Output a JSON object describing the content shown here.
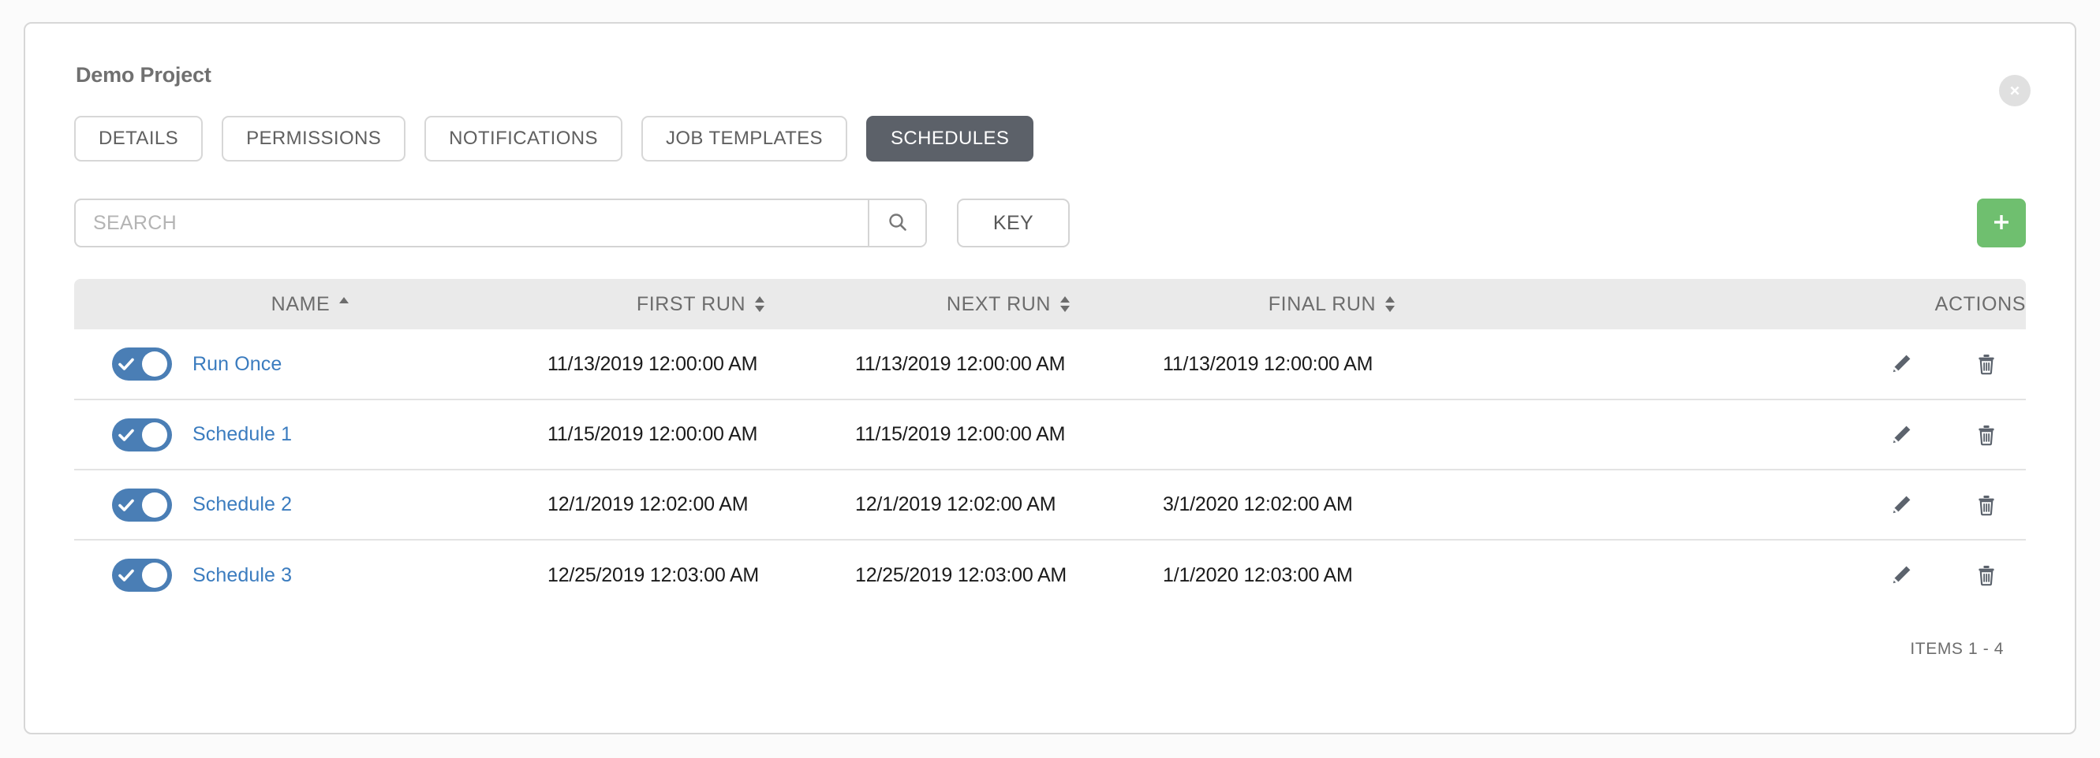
{
  "header": {
    "title": "Demo Project",
    "close_icon": "close-circle-icon"
  },
  "tabs": [
    {
      "label": "DETAILS",
      "active": false
    },
    {
      "label": "PERMISSIONS",
      "active": false
    },
    {
      "label": "NOTIFICATIONS",
      "active": false
    },
    {
      "label": "JOB TEMPLATES",
      "active": false
    },
    {
      "label": "SCHEDULES",
      "active": true
    }
  ],
  "toolbar": {
    "search_placeholder": "SEARCH",
    "search_value": "",
    "search_icon": "search-icon",
    "key_label": "KEY",
    "add_icon": "plus-icon",
    "add_color": "#6fbf6f"
  },
  "table": {
    "columns": [
      {
        "label": "NAME",
        "sort": "asc"
      },
      {
        "label": "FIRST RUN",
        "sort": "none"
      },
      {
        "label": "NEXT RUN",
        "sort": "none"
      },
      {
        "label": "FINAL RUN",
        "sort": "none"
      },
      {
        "label": "ACTIONS",
        "sort": null
      }
    ],
    "rows": [
      {
        "enabled": true,
        "name": "Run Once",
        "first_run": "11/13/2019 12:00:00 AM",
        "next_run": "11/13/2019 12:00:00 AM",
        "final_run": "11/13/2019 12:00:00 AM"
      },
      {
        "enabled": true,
        "name": "Schedule 1",
        "first_run": "11/15/2019 12:00:00 AM",
        "next_run": "11/15/2019 12:00:00 AM",
        "final_run": ""
      },
      {
        "enabled": true,
        "name": "Schedule 2",
        "first_run": "12/1/2019 12:02:00 AM",
        "next_run": "12/1/2019 12:02:00 AM",
        "final_run": "3/1/2020 12:02:00 AM"
      },
      {
        "enabled": true,
        "name": "Schedule 3",
        "first_run": "12/25/2019 12:03:00 AM",
        "next_run": "12/25/2019 12:03:00 AM",
        "final_run": "1/1/2020 12:03:00 AM"
      }
    ],
    "row_actions": [
      {
        "icon": "pencil-icon"
      },
      {
        "icon": "trash-icon"
      }
    ]
  },
  "footer": {
    "items_label": "ITEMS  1 - 4"
  },
  "colors": {
    "toggle_on": "#4a7eb5",
    "link": "#3b7cbf",
    "active_tab": "#5c6169",
    "add_button": "#6fbf6f",
    "header_row": "#eaeaea"
  }
}
